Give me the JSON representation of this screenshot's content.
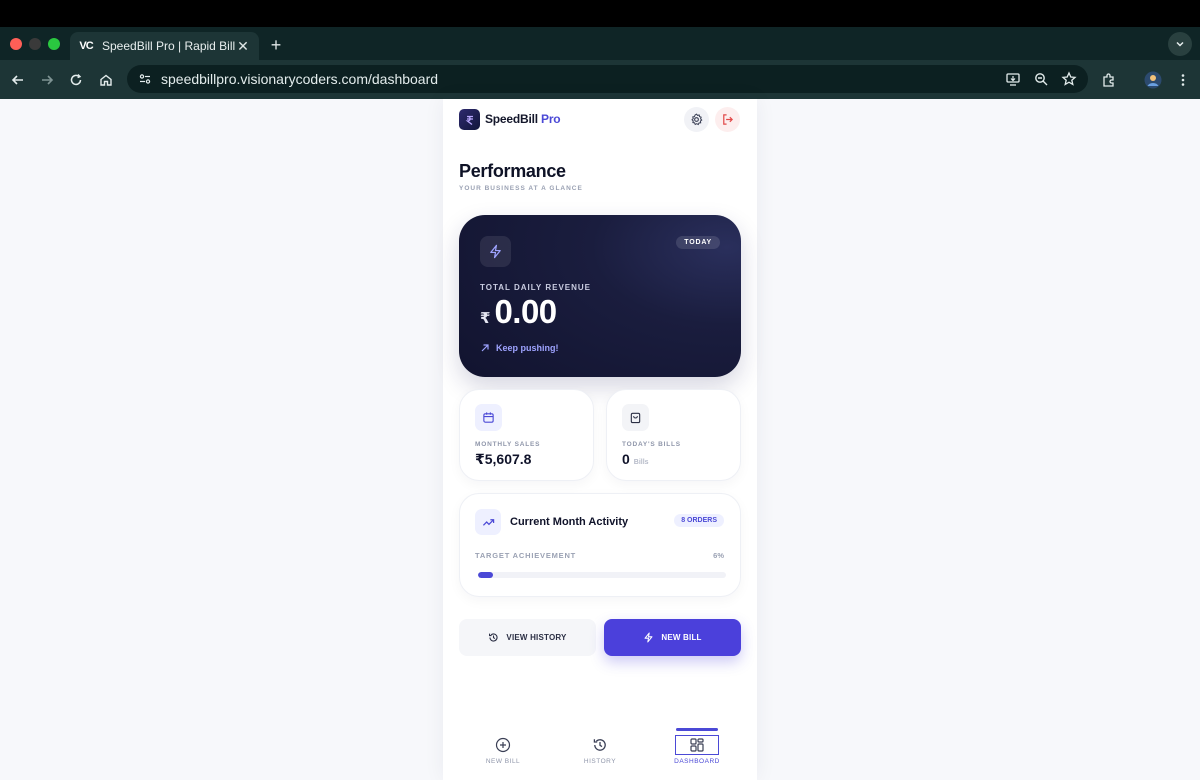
{
  "browser": {
    "tab_title": "SpeedBill Pro | Rapid Billing b",
    "tab_favicon": "VC",
    "url": "speedbillpro.visionarycoders.com/dashboard"
  },
  "app": {
    "brand_name": "SpeedBill",
    "brand_suffix": "Pro",
    "page_title": "Performance",
    "page_subtitle": "YOUR BUSINESS AT A GLANCE",
    "hero": {
      "badge": "TODAY",
      "label": "TOTAL DAILY REVENUE",
      "currency": "₹",
      "amount": "0.00",
      "footer": "Keep pushing!"
    },
    "stats": [
      {
        "label": "MONTHLY SALES",
        "value": "₹5,607.8",
        "unit": ""
      },
      {
        "label": "TODAY'S BILLS",
        "value": "0",
        "unit": "Bills"
      }
    ],
    "activity": {
      "title": "Current Month Activity",
      "badge": "8 ORDERS",
      "target_label": "TARGET ACHIEVEMENT",
      "target_pct_text": "6%",
      "target_fraction": 0.06
    },
    "buttons": {
      "view_history": "VIEW HISTORY",
      "new_bill": "NEW BILL"
    },
    "bottom_nav": [
      {
        "label": "NEW BILL",
        "icon": "plus-circle-icon"
      },
      {
        "label": "HISTORY",
        "icon": "history-icon"
      },
      {
        "label": "DASHBOARD",
        "icon": "dashboard-grid-icon",
        "active": true
      }
    ],
    "accent_color": "#4b49d6"
  }
}
